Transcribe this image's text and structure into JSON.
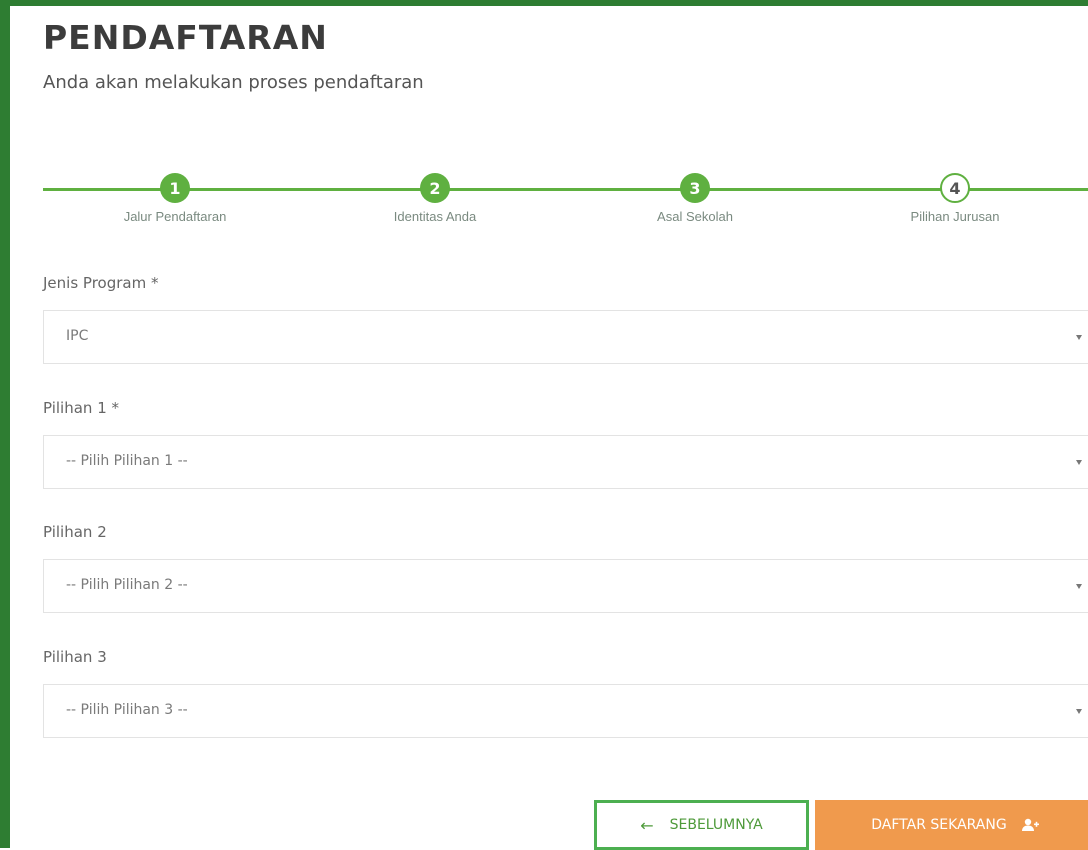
{
  "header": {
    "title": "PENDAFTARAN",
    "subtitle": "Anda akan melakukan proses pendaftaran"
  },
  "stepper": {
    "steps": [
      {
        "number": "1",
        "label": "Jalur Pendaftaran",
        "status": "completed"
      },
      {
        "number": "2",
        "label": "Identitas Anda",
        "status": "completed"
      },
      {
        "number": "3",
        "label": "Asal Sekolah",
        "status": "completed"
      },
      {
        "number": "4",
        "label": "Pilihan Jurusan",
        "status": "current"
      }
    ]
  },
  "form": {
    "jenis_program": {
      "label": "Jenis Program *",
      "value": "IPC"
    },
    "pilihan_1": {
      "label": "Pilihan 1 *",
      "value": "-- Pilih Pilihan 1 --"
    },
    "pilihan_2": {
      "label": "Pilihan 2",
      "value": "-- Pilih Pilihan 2 --"
    },
    "pilihan_3": {
      "label": "Pilihan 3",
      "value": "-- Pilih Pilihan 3 --"
    }
  },
  "actions": {
    "prev_label": "SEBELUMNYA",
    "prev_icon": "arrow-left-icon",
    "submit_label": "DAFTAR SEKARANG",
    "submit_icon": "user-add-icon"
  },
  "colors": {
    "accent_green": "#5fb040",
    "border_green": "#2e7d32",
    "submit_orange": "#f09a4d"
  }
}
